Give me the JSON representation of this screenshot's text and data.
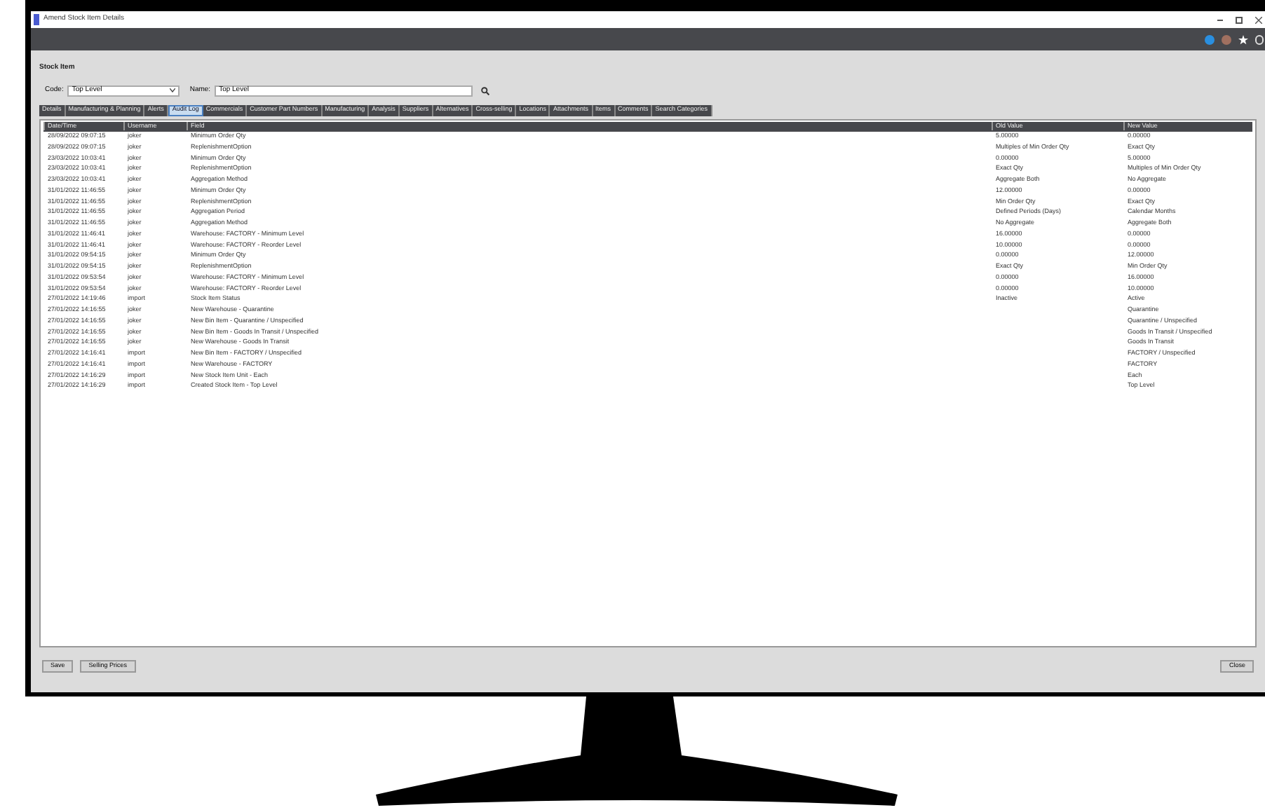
{
  "window": {
    "title": "Amend Stock Item Details"
  },
  "section_title": "Stock Item",
  "code": {
    "label": "Code:",
    "value": "Top Level"
  },
  "name": {
    "label": "Name:",
    "value": "Top Level"
  },
  "tabs": [
    {
      "label": "Details",
      "selected": false
    },
    {
      "label": "Manufacturing & Planning",
      "selected": false
    },
    {
      "label": "Alerts",
      "selected": false
    },
    {
      "label": "Audit Log",
      "selected": true
    },
    {
      "label": "Commercials",
      "selected": false
    },
    {
      "label": "Customer Part Numbers",
      "selected": false
    },
    {
      "label": "Manufacturing",
      "selected": false
    },
    {
      "label": "Analysis",
      "selected": false
    },
    {
      "label": "Suppliers",
      "selected": false
    },
    {
      "label": "Alternatives",
      "selected": false
    },
    {
      "label": "Cross-selling",
      "selected": false
    },
    {
      "label": "Locations",
      "selected": false
    },
    {
      "label": "Attachments",
      "selected": false
    },
    {
      "label": "Items",
      "selected": false
    },
    {
      "label": "Comments",
      "selected": false
    },
    {
      "label": "Search Categories",
      "selected": false
    }
  ],
  "table": {
    "columns": [
      "Date/Time",
      "Username",
      "Field",
      "Old Value",
      "New Value"
    ],
    "rows": [
      [
        "28/09/2022 09:07:15",
        "joker",
        "Minimum Order Qty",
        "5.00000",
        "0.00000"
      ],
      [
        "28/09/2022 09:07:15",
        "joker",
        "ReplenishmentOption",
        "Multiples of Min Order Qty",
        "Exact Qty"
      ],
      [
        "23/03/2022 10:03:41",
        "joker",
        "Minimum Order Qty",
        "0.00000",
        "5.00000"
      ],
      [
        "23/03/2022 10:03:41",
        "joker",
        "ReplenishmentOption",
        "Exact Qty",
        "Multiples of Min Order Qty"
      ],
      [
        "23/03/2022 10:03:41",
        "joker",
        "Aggregation Method",
        "Aggregate Both",
        "No Aggregate"
      ],
      [
        "31/01/2022 11:46:55",
        "joker",
        "Minimum Order Qty",
        "12.00000",
        "0.00000"
      ],
      [
        "31/01/2022 11:46:55",
        "joker",
        "ReplenishmentOption",
        "Min Order Qty",
        "Exact Qty"
      ],
      [
        "31/01/2022 11:46:55",
        "joker",
        "Aggregation Period",
        "Defined Periods (Days)",
        "Calendar Months"
      ],
      [
        "31/01/2022 11:46:55",
        "joker",
        "Aggregation Method",
        "No Aggregate",
        "Aggregate Both"
      ],
      [
        "31/01/2022 11:46:41",
        "joker",
        "Warehouse: FACTORY - Minimum Level",
        "16.00000",
        "0.00000"
      ],
      [
        "31/01/2022 11:46:41",
        "joker",
        "Warehouse: FACTORY - Reorder Level",
        "10.00000",
        "0.00000"
      ],
      [
        "31/01/2022 09:54:15",
        "joker",
        "Minimum Order Qty",
        "0.00000",
        "12.00000"
      ],
      [
        "31/01/2022 09:54:15",
        "joker",
        "ReplenishmentOption",
        "Exact Qty",
        "Min Order Qty"
      ],
      [
        "31/01/2022 09:53:54",
        "joker",
        "Warehouse: FACTORY - Minimum Level",
        "0.00000",
        "16.00000"
      ],
      [
        "31/01/2022 09:53:54",
        "joker",
        "Warehouse: FACTORY - Reorder Level",
        "0.00000",
        "10.00000"
      ],
      [
        "27/01/2022 14:19:46",
        "import",
        "Stock Item Status",
        "Inactive",
        "Active"
      ],
      [
        "27/01/2022 14:16:55",
        "joker",
        "New Warehouse - Quarantine",
        "",
        "Quarantine"
      ],
      [
        "27/01/2022 14:16:55",
        "joker",
        "New Bin Item - Quarantine / Unspecified",
        "",
        "Quarantine / Unspecified"
      ],
      [
        "27/01/2022 14:16:55",
        "joker",
        "New Bin Item - Goods In Transit / Unspecified",
        "",
        "Goods In Transit / Unspecified"
      ],
      [
        "27/01/2022 14:16:55",
        "joker",
        "New Warehouse - Goods In Transit",
        "",
        "Goods In Transit"
      ],
      [
        "27/01/2022 14:16:41",
        "import",
        "New Bin Item - FACTORY / Unspecified",
        "",
        "FACTORY / Unspecified"
      ],
      [
        "27/01/2022 14:16:41",
        "import",
        "New Warehouse - FACTORY",
        "",
        "FACTORY"
      ],
      [
        "27/01/2022 14:16:29",
        "import",
        "New Stock Item Unit - Each",
        "",
        "Each"
      ],
      [
        "27/01/2022 14:16:29",
        "import",
        "Created Stock Item - Top Level",
        "",
        "Top Level"
      ]
    ]
  },
  "buttons_left": [
    "Save",
    "Selling Prices"
  ],
  "buttons_right": [
    "Close"
  ]
}
